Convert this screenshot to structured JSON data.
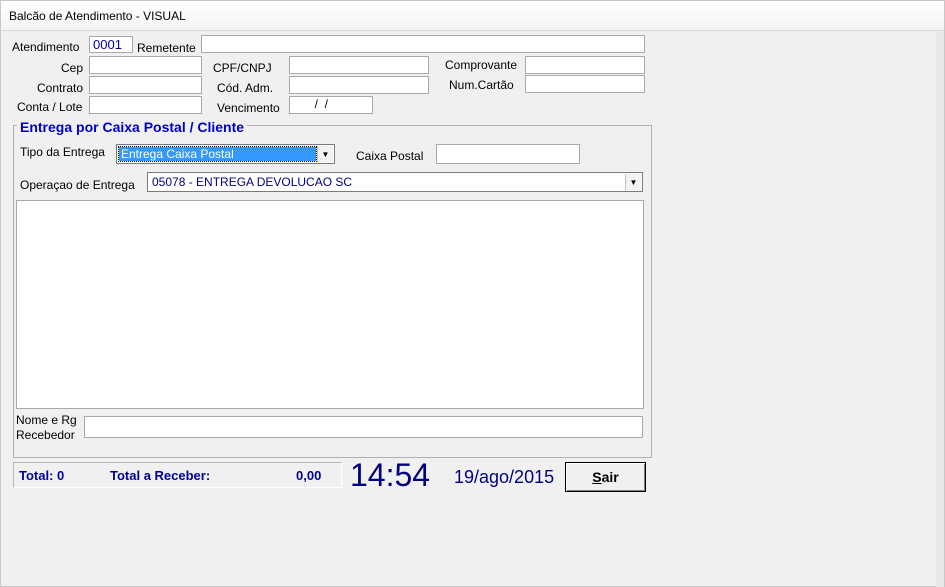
{
  "window": {
    "title": "Balcão de Atendimento - VISUAL"
  },
  "form": {
    "atendimento_label": "Atendimento",
    "atendimento_value": "0001",
    "remetente_label": "Remetente",
    "remetente_value": "",
    "cep_label": "Cep",
    "cep_value": "",
    "contrato_label": "Contrato",
    "contrato_value": "",
    "conta_lote_label": "Conta / Lote",
    "conta_lote_value": "",
    "cpf_cnpj_label": "CPF/CNPJ",
    "cpf_cnpj_value": "",
    "cod_adm_label": "Cód. Adm.",
    "cod_adm_value": "",
    "vencimento_label": "Vencimento",
    "vencimento_value": "  /  /",
    "comprovante_label": "Comprovante",
    "comprovante_value": "",
    "num_cartao_label": "Num.Cartão",
    "num_cartao_value": ""
  },
  "delivery": {
    "group_title": "Entrega por Caixa Postal / Cliente",
    "tipo_label": "Tipo da Entrega",
    "tipo_value": "Entrega Caixa Postal",
    "caixa_postal_label": "Caixa Postal",
    "caixa_postal_value": "",
    "operacao_label": "Operaçao de Entrega",
    "operacao_value": "05078 - ENTREGA DEVOLUCAO SC",
    "recebedor_label_1": "Nome e Rg",
    "recebedor_label_2": "Recebedor",
    "recebedor_value": ""
  },
  "status": {
    "total_label": "Total: 0",
    "total_receber_label": "Total a Receber:",
    "total_receber_value": "0,00",
    "clock": "14:54",
    "date": "19/ago/2015"
  },
  "buttons": {
    "sair_underline": "S",
    "sair_rest": "air"
  },
  "icons": {
    "dropdown": "chevron-down-icon"
  }
}
